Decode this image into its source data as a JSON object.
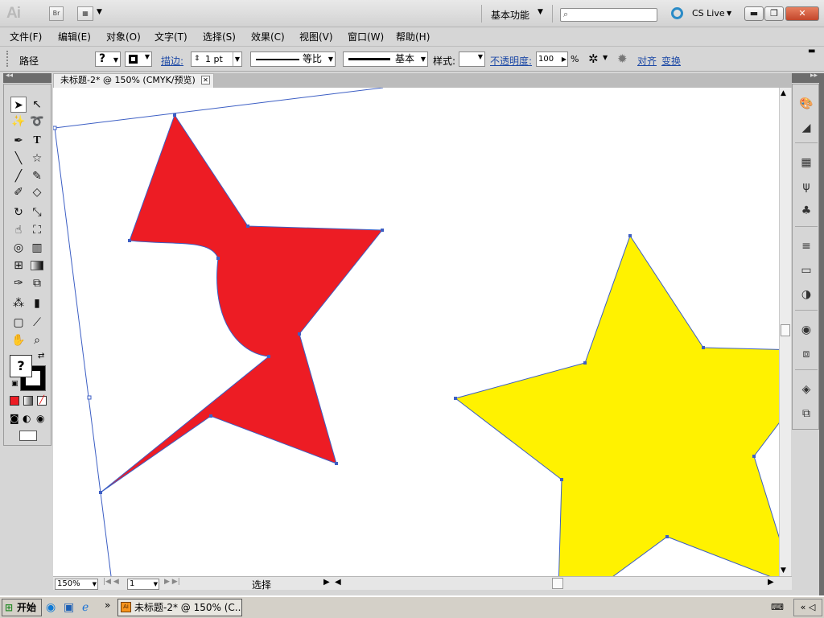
{
  "app": {
    "logo": "Ai",
    "bridge": "Br",
    "workspace": "基本功能",
    "cslive": "CS Live"
  },
  "menu": [
    "文件(F)",
    "编辑(E)",
    "对象(O)",
    "文字(T)",
    "选择(S)",
    "效果(C)",
    "视图(V)",
    "窗口(W)",
    "帮助(H)"
  ],
  "control": {
    "selection_type": "路径",
    "fill_label": "?",
    "stroke_label": "描边:",
    "stroke_weight": "1 pt",
    "profile_label": "等比",
    "brush_label": "基本",
    "style_label": "样式:",
    "opacity_label": "不透明度:",
    "opacity_value": "100",
    "opacity_unit": "%",
    "align_label": "对齐",
    "transform_label": "变换"
  },
  "document": {
    "tab_title": "未标题-2* @ 150% (CMYK/预览)"
  },
  "statusbar": {
    "zoom": "150%",
    "artboard": "1",
    "status": "选择"
  },
  "taskbar": {
    "start": "开始",
    "task_title": "未标题-2* @ 150% (C..."
  },
  "colors": {
    "red_star": "#ed1c24",
    "yellow_star": "#fff200",
    "path": "#3d5fc4"
  },
  "icons": {
    "toolbox": [
      "selection-icon",
      "direct-selection-icon",
      "magic-wand-icon",
      "lasso-icon",
      "pen-icon",
      "type-icon",
      "line-icon",
      "star-icon",
      "paintbrush-icon",
      "pencil-icon",
      "blob-brush-icon",
      "eraser-icon",
      "rotate-icon",
      "scale-icon",
      "warp-icon",
      "free-transform-icon",
      "shape-builder-icon",
      "perspective-grid-icon",
      "mesh-icon",
      "gradient-icon",
      "eyedropper-icon",
      "blend-icon",
      "symbol-sprayer-icon",
      "column-graph-icon",
      "artboard-icon",
      "slice-icon",
      "hand-icon",
      "zoom-icon"
    ]
  }
}
